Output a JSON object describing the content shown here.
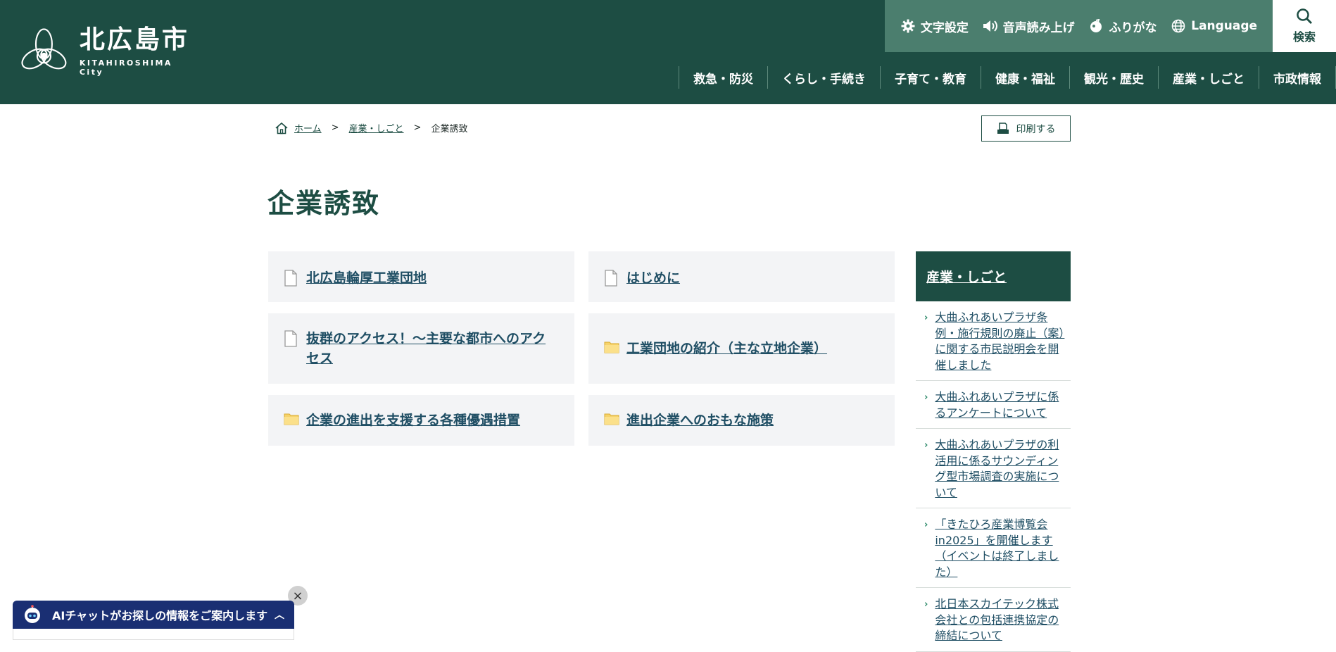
{
  "header": {
    "logo_title": "北広島市",
    "logo_sub": "KITAHIROSHIMA City",
    "utilities": [
      {
        "label": "文字設定",
        "icon": "gear-icon"
      },
      {
        "label": "音声読み上げ",
        "icon": "speaker-icon"
      },
      {
        "label": "ふりがな",
        "icon": "furigana-icon"
      },
      {
        "label": "Language",
        "icon": "globe-icon"
      }
    ],
    "search_label": "検索",
    "nav": [
      "救急・防災",
      "くらし・手続き",
      "子育て・教育",
      "健康・福祉",
      "観光・歴史",
      "産業・しごと",
      "市政情報"
    ]
  },
  "breadcrumb": {
    "home": "ホーム",
    "sep": ">",
    "level1": "産業・しごと",
    "current": "企業誘致"
  },
  "print_label": "印刷する",
  "page_title": "企業誘致",
  "cards": [
    {
      "label": "北広島輪厚工業団地",
      "icon": "page-icon"
    },
    {
      "label": "はじめに",
      "icon": "page-icon"
    },
    {
      "label": "抜群のアクセス！～主要な都市へのアクセス",
      "icon": "page-icon"
    },
    {
      "label": "工業団地の紹介（主な立地企業）",
      "icon": "folder-icon"
    },
    {
      "label": "企業の進出を支援する各種優遇措置",
      "icon": "folder-icon"
    },
    {
      "label": "進出企業へのおもな施策",
      "icon": "folder-icon"
    }
  ],
  "sidebar": {
    "title": "産業・しごと",
    "items": [
      "大曲ふれあいプラザ条例・施行規則の廃止（案）に関する市民説明会を開催しました",
      "大曲ふれあいプラザに係るアンケートについて",
      "大曲ふれあいプラザの利活用に係るサウンディング型市場調査の実施について",
      "「きたひろ産業博覧会in2025」を開催します（イベントは終了しました）",
      "北日本スカイテック株式会社との包括連携協定の締結について"
    ]
  },
  "chat": {
    "label": "AIチャットがお探しの情報をご案内します",
    "close": "×",
    "toggle": "︿"
  },
  "colors": {
    "brand": "#1d4d43",
    "util_bar": "#4b7e6e",
    "link": "#1f4e64",
    "chat": "#1a2f73"
  }
}
